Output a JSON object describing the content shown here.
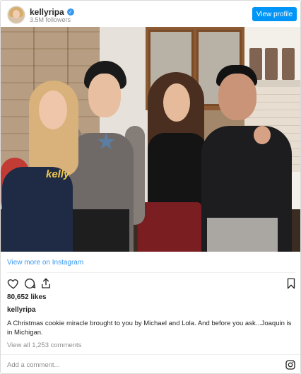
{
  "header": {
    "username": "kellyripa",
    "verified": true,
    "followers": "3.5M followers",
    "view_profile_label": "View profile"
  },
  "post": {
    "image_alt": "Four people posing together in a studio kitchen set",
    "logo_text": "kelly"
  },
  "actions": {
    "view_more_label": "View more on Instagram",
    "icons": [
      "heart-icon",
      "comment-icon",
      "share-icon",
      "bookmark-icon"
    ]
  },
  "likes": "80,652 likes",
  "caption": {
    "username": "kellyripa",
    "text": "A Christmas cookie miracle brought to you by Michael and Lola. And before you ask...Joaquin is in Michigan."
  },
  "comments": {
    "view_all_label": "View all 1,253 comments",
    "add_comment_placeholder": "Add a comment..."
  },
  "colors": {
    "accent": "#0095f6",
    "link": "#3897f0",
    "muted": "#8e8e8e",
    "text": "#262626"
  }
}
